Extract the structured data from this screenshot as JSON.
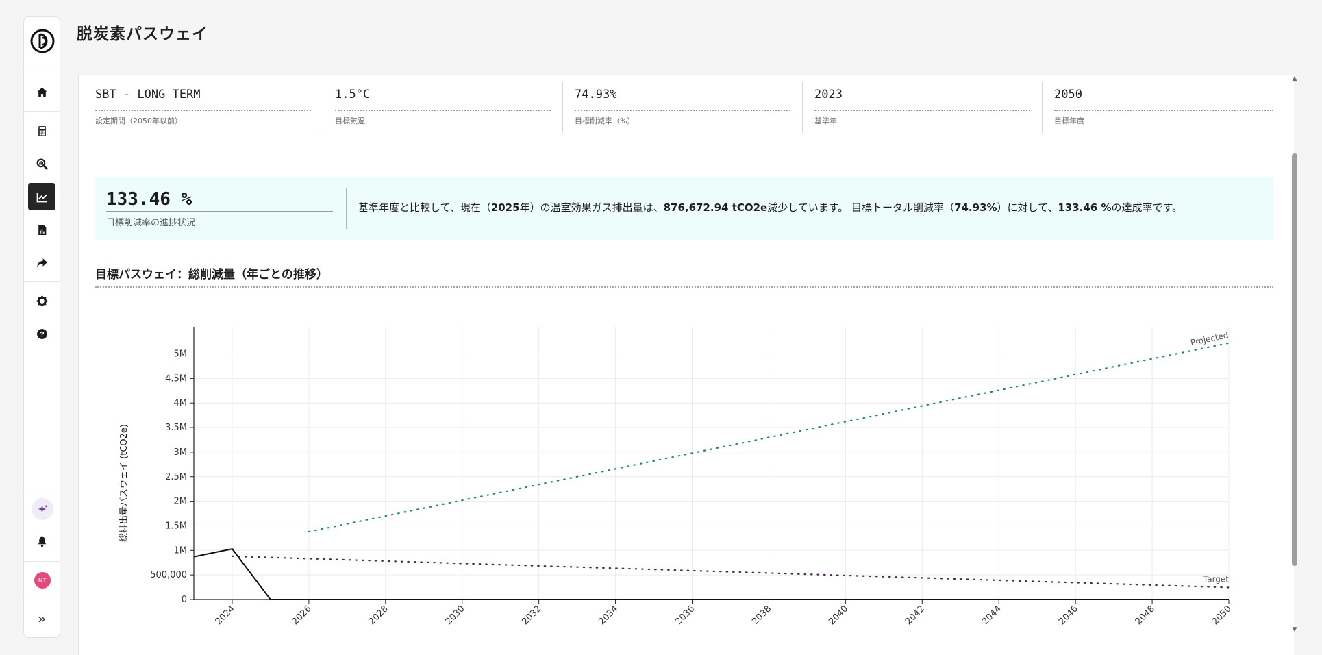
{
  "page": {
    "title": "脱炭素パスウェイ"
  },
  "sidebar": {
    "items": [
      {
        "icon": "home-icon"
      },
      {
        "icon": "calculator-icon"
      },
      {
        "icon": "search-chart-icon"
      },
      {
        "icon": "line-chart-icon",
        "active": true
      },
      {
        "icon": "report-icon"
      },
      {
        "icon": "share-icon"
      },
      {
        "icon": "gear-icon"
      },
      {
        "icon": "help-icon"
      }
    ],
    "ai_icon": "sparkle-icon",
    "bell_icon": "bell-icon",
    "avatar_initials": "NT",
    "expand_label": "»"
  },
  "params": [
    {
      "value": "SBT - LONG TERM",
      "label": "設定期間（2050年以前）"
    },
    {
      "value": "1.5°C",
      "label": "目標気温"
    },
    {
      "value": "74.93%",
      "label": "目標削減率（%）"
    },
    {
      "value": "2023",
      "label": "基準年"
    },
    {
      "value": "2050",
      "label": "目標年度"
    }
  ],
  "progress": {
    "value": "133.46 %",
    "label": "目標削減率の進捗状況",
    "text": {
      "p1": "基準年度と比較して、現在（",
      "b1": "2025",
      "p2": "年）の温室効果ガス排出量は、",
      "b2": "876,672.94 tCO2e",
      "p3": "減少しています。 目標トータル削減率（",
      "b3": "74.93%",
      "p4": "）に対して、",
      "b4": "133.46 %",
      "p5": "の達成率です。"
    }
  },
  "section_title": "目標パスウェイ：総削減量（年ごとの推移）",
  "colors": {
    "projected": "#1a8a6a",
    "target": "#4a2650",
    "actual": "#111111",
    "progress_bg": "#edfdfb"
  },
  "chart_data": {
    "type": "line",
    "ylabel": "総排出量パスウェイ (tCO2e)",
    "xlim": [
      2023,
      2050
    ],
    "ylim": [
      0,
      5300000
    ],
    "x_ticks": [
      2024,
      2026,
      2028,
      2030,
      2032,
      2034,
      2036,
      2038,
      2040,
      2042,
      2044,
      2046,
      2048,
      2050
    ],
    "y_ticks": [
      0,
      500000,
      1000000,
      1500000,
      2000000,
      2500000,
      3000000,
      3500000,
      4000000,
      4500000,
      5000000
    ],
    "y_tick_labels": [
      "0",
      "500,000",
      "1M",
      "1.5M",
      "2M",
      "2.5M",
      "3M",
      "3.5M",
      "4M",
      "4.5M",
      "5M"
    ],
    "series": [
      {
        "name": "Projected",
        "style": "dotted",
        "x": [
          2026,
          2050
        ],
        "y": [
          1380000,
          5220000
        ]
      },
      {
        "name": "Target",
        "style": "dotted",
        "x": [
          2024,
          2050
        ],
        "y": [
          880000,
          245000
        ]
      },
      {
        "style": "solid",
        "x": [
          2023,
          2024,
          2025,
          2050
        ],
        "y": [
          870000,
          1030000,
          0,
          0
        ]
      }
    ]
  }
}
